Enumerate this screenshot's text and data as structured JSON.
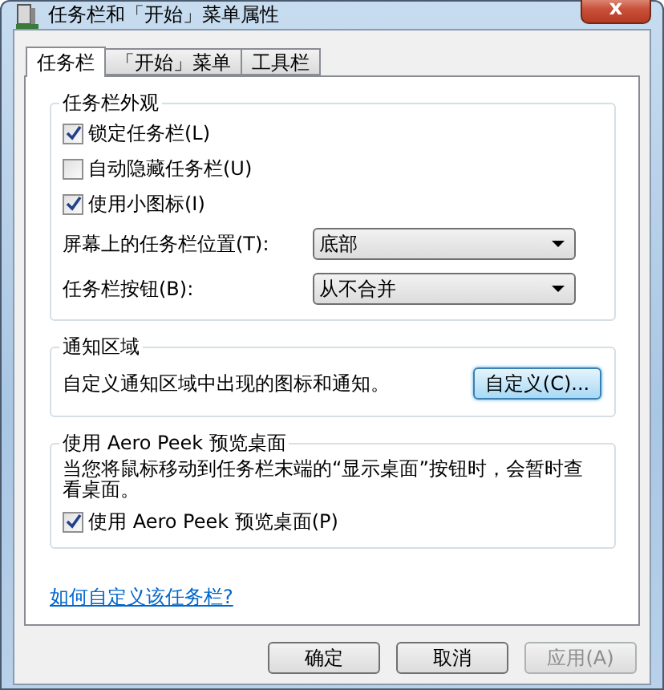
{
  "window": {
    "title": "任务栏和「开始」菜单属性",
    "close": "x"
  },
  "tabs": [
    {
      "label": "任务栏",
      "selected": true
    },
    {
      "label": "「开始」菜单",
      "selected": false
    },
    {
      "label": "工具栏",
      "selected": false
    }
  ],
  "groups": [
    {
      "title": "任务栏外观",
      "items": [
        {
          "kind": "checkbox",
          "label": "锁定任务栏(L)",
          "checked": true
        },
        {
          "kind": "checkbox",
          "label": "自动隐藏任务栏(U)",
          "checked": false
        },
        {
          "kind": "checkbox",
          "label": "使用小图标(I)",
          "checked": true
        },
        {
          "kind": "dropdown",
          "label": "屏幕上的任务栏位置(T):",
          "value": "底部"
        },
        {
          "kind": "dropdown",
          "label": "任务栏按钮(B):",
          "value": "从不合并"
        }
      ]
    },
    {
      "title": "通知区域",
      "items": [
        {
          "kind": "text_button",
          "label": "自定义通知区域中出现的图标和通知。",
          "button": "自定义(C)...",
          "focused": true
        }
      ]
    },
    {
      "title": "使用 Aero Peek 预览桌面",
      "items": [
        {
          "kind": "paragraph",
          "label": "当您将鼠标移动到任务栏末端的“显示桌面”按钮时，会暂时查看桌面。"
        },
        {
          "kind": "checkbox",
          "label": "使用 Aero Peek 预览桌面(P)",
          "checked": true
        }
      ]
    }
  ],
  "link": "如何自定义该任务栏?",
  "buttons": [
    {
      "label": "确定",
      "disabled": false
    },
    {
      "label": "取消",
      "disabled": false
    },
    {
      "label": "应用(A)",
      "disabled": true
    }
  ]
}
